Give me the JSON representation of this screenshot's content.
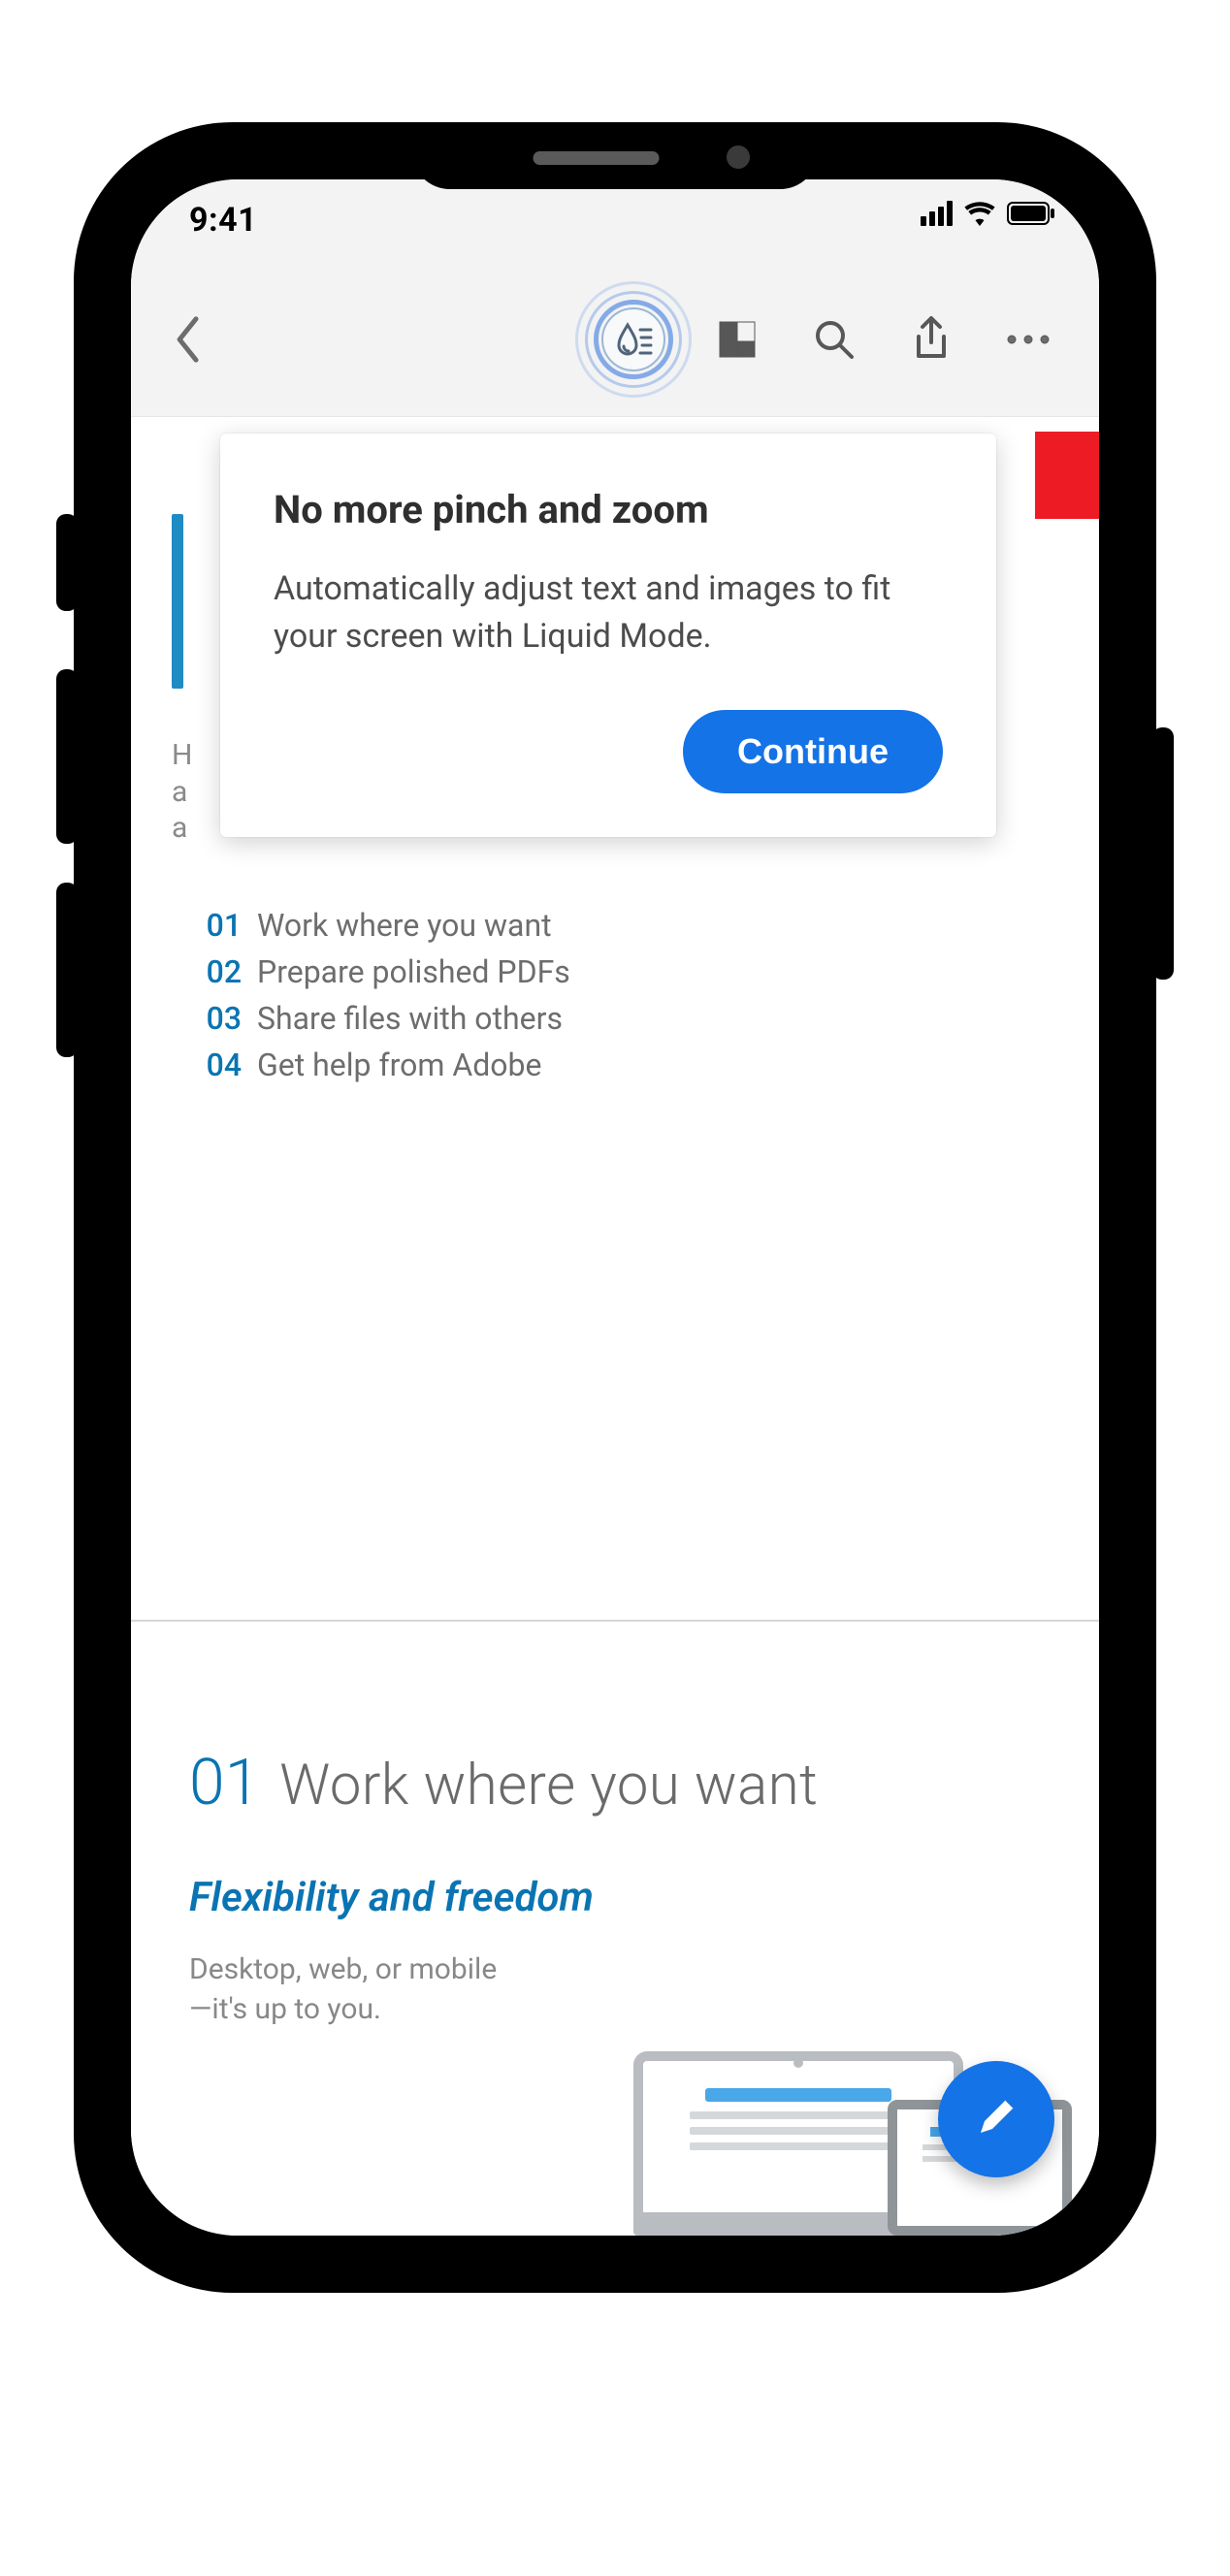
{
  "status": {
    "time": "9:41"
  },
  "toolbar": {
    "back_icon": "chevron-left",
    "liquid_icon": "liquid-mode",
    "pages_icon": "page-thumbnails",
    "search_icon": "search",
    "share_icon": "share",
    "more_icon": "more"
  },
  "popover": {
    "title": "No more pinch and zoom",
    "body": "Automatically adjust text and images to fit your screen with Liquid Mode.",
    "continue_label": "Continue"
  },
  "document": {
    "bg_paragraph": "H\na\na",
    "toc": [
      {
        "num": "01",
        "text": "Work where you want"
      },
      {
        "num": "02",
        "text": "Prepare polished PDFs"
      },
      {
        "num": "03",
        "text": "Share files with others"
      },
      {
        "num": "04",
        "text": "Get help from Adobe"
      }
    ],
    "section": {
      "num": "01",
      "title": "Work where you want",
      "subtitle": "Flexibility and freedom",
      "body": "Desktop, web, or mobile—it's up to you."
    }
  },
  "fab": {
    "icon": "pencil"
  }
}
